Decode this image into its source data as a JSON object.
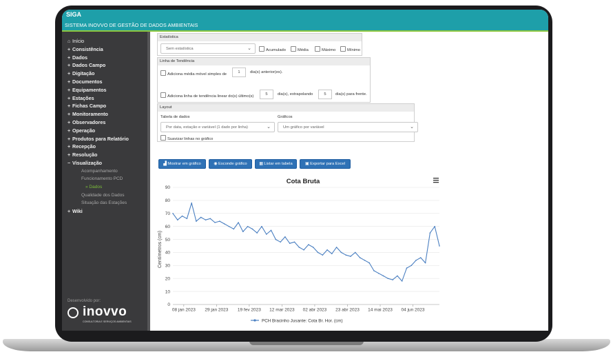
{
  "header": {
    "title": "SIGA",
    "subtitle": "SISTEMA INOVVO DE GESTÃO DE DADOS AMBIENTAIS"
  },
  "sidebar": {
    "home_label": "Início",
    "items": [
      {
        "label": "Consistência"
      },
      {
        "label": "Dados"
      },
      {
        "label": "Dados Campo"
      },
      {
        "label": "Digitação"
      },
      {
        "label": "Documentos"
      },
      {
        "label": "Equipamentos"
      },
      {
        "label": "Estações"
      },
      {
        "label": "Fichas Campo"
      },
      {
        "label": "Monitoramento"
      },
      {
        "label": "Observadores"
      },
      {
        "label": "Operação"
      },
      {
        "label": "Produtos para Relatório"
      },
      {
        "label": "Recepção"
      },
      {
        "label": "Resolução"
      },
      {
        "label": "Visualização"
      }
    ],
    "sub_items": [
      {
        "label": "Acompanhamento"
      },
      {
        "label": "Funcionamento PCD"
      },
      {
        "label": "» Dados"
      },
      {
        "label": "Qualidade dos Dados"
      },
      {
        "label": "Situação das Estações"
      }
    ],
    "wiki_label": "Wiki",
    "footer": {
      "developed_by": "Desenvolvido por:",
      "logo_text": "inovvo",
      "logo_tagline": "CONSULTORIA E SERVIÇOS AMBIENTAIS"
    }
  },
  "filters": {
    "statistics": {
      "header": "Estatística",
      "select_value": "Sem estatística",
      "options": [
        "Acumulado",
        "Média",
        "Máximo",
        "Mínimo"
      ]
    },
    "trend": {
      "header": "Linha de Tendência",
      "moving_avg_label": "Adiciona média móvel simples de",
      "moving_avg_days": "1",
      "moving_avg_suffix": "dia(s) anterior(es).",
      "linear_label": "Adiciona linha de tendência linear do(s) último(s)",
      "linear_days": "5",
      "linear_mid": "dia(s), extrapolando",
      "extrapolate_days": "5",
      "linear_suffix": "dia(s) para frente."
    },
    "layout": {
      "header": "Layout",
      "table_label": "Tabela de dados",
      "table_value": "Por data, estação e variável (1 dado por linha)",
      "charts_label": "Gráficos",
      "charts_value": "Um gráfico por variável",
      "smooth_label": "Suavizar linhas no gráfico"
    }
  },
  "buttons": {
    "show_chart": "Mostrar em gráfico",
    "hide_chart": "Esconde gráfico",
    "list_table": "Listar em tabela",
    "export_excel": "Exportar para Excel"
  },
  "colors": {
    "header": "#1e9fa9",
    "accent_line": "#8dc63f",
    "sidebar": "#3a3a3c",
    "button": "#2f72b6",
    "series": "#4a7fc1"
  },
  "chart_data": {
    "type": "line",
    "title": "Cota Bruta",
    "ylabel": "Centímetros (cm)",
    "xlabel": "",
    "ylim": [
      0,
      90
    ],
    "yticks": [
      0,
      10,
      20,
      30,
      40,
      50,
      60,
      70,
      80,
      90
    ],
    "xticks": [
      "08 jan 2023",
      "29 jan 2023",
      "19 fev 2023",
      "12 mar 2023",
      "02 abr 2023",
      "23 abr 2023",
      "14 mai 2023",
      "04 jun 2023"
    ],
    "grid": true,
    "legend": "bottom-center",
    "series": [
      {
        "name": "PCH Bracinho Jusante: Cota Br. Hor. (cm)",
        "x": [
          "2023-01-01",
          "2023-01-04",
          "2023-01-07",
          "2023-01-10",
          "2023-01-13",
          "2023-01-16",
          "2023-01-19",
          "2023-01-22",
          "2023-01-25",
          "2023-01-28",
          "2023-01-31",
          "2023-02-03",
          "2023-02-06",
          "2023-02-09",
          "2023-02-12",
          "2023-02-15",
          "2023-02-18",
          "2023-02-21",
          "2023-02-24",
          "2023-02-27",
          "2023-03-02",
          "2023-03-05",
          "2023-03-08",
          "2023-03-11",
          "2023-03-14",
          "2023-03-17",
          "2023-03-20",
          "2023-03-23",
          "2023-03-26",
          "2023-03-29",
          "2023-04-01",
          "2023-04-04",
          "2023-04-07",
          "2023-04-10",
          "2023-04-13",
          "2023-04-16",
          "2023-04-19",
          "2023-04-22",
          "2023-04-25",
          "2023-04-28",
          "2023-05-01",
          "2023-05-04",
          "2023-05-07",
          "2023-05-10",
          "2023-05-13",
          "2023-05-16",
          "2023-05-19",
          "2023-05-22",
          "2023-05-25",
          "2023-05-28",
          "2023-05-31",
          "2023-06-03",
          "2023-06-06",
          "2023-06-09",
          "2023-06-12",
          "2023-06-15",
          "2023-06-18",
          "2023-06-21"
        ],
        "y": [
          70,
          65,
          68,
          66,
          78,
          64,
          67,
          65,
          66,
          63,
          64,
          62,
          60,
          58,
          63,
          56,
          60,
          58,
          55,
          60,
          54,
          57,
          50,
          48,
          52,
          47,
          48,
          44,
          42,
          46,
          44,
          40,
          38,
          42,
          39,
          44,
          40,
          38,
          37,
          40,
          36,
          34,
          32,
          26,
          24,
          22,
          20,
          19,
          22,
          18,
          28,
          30,
          34,
          36,
          32,
          55,
          60,
          45
        ]
      }
    ]
  }
}
